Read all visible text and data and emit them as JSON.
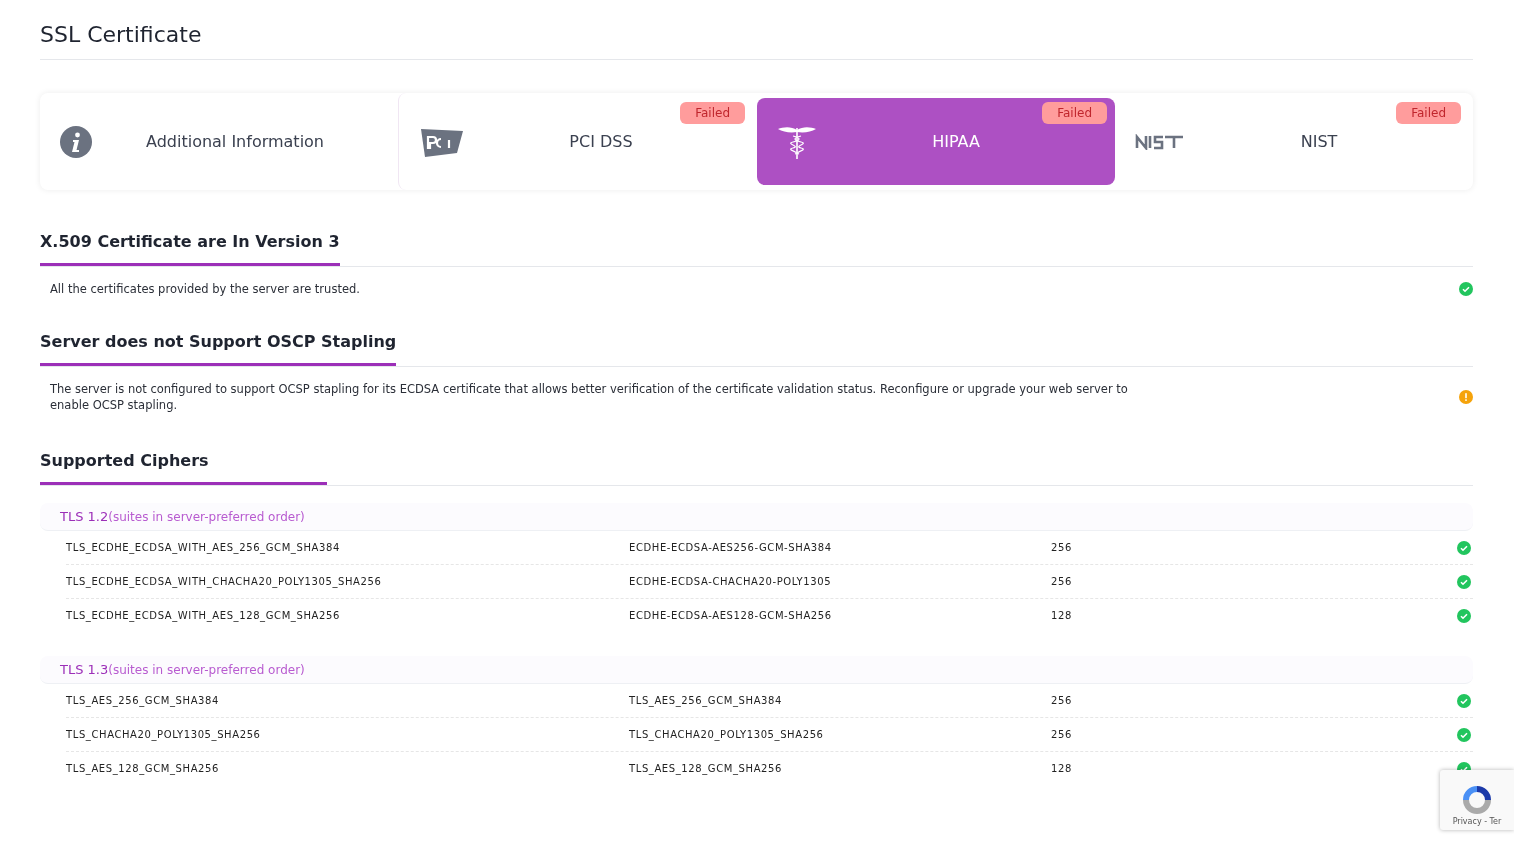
{
  "title": "SSL Certificate",
  "tabs": [
    {
      "kind": "info",
      "label": "Additional Information",
      "selected": false
    },
    {
      "kind": "pci",
      "label": "PCI DSS",
      "selected": false,
      "badge": "Failed"
    },
    {
      "kind": "hipaa",
      "label": "HIPAA",
      "selected": true,
      "badge": "Failed"
    },
    {
      "kind": "nist",
      "label": "NIST",
      "selected": false,
      "badge": "Failed"
    }
  ],
  "sections": [
    {
      "heading": "X.509 Certificate are In Version 3",
      "text": "All the certificates provided by the server are trusted.",
      "warning": false
    },
    {
      "heading": "Server does not Support OSCP Stapling",
      "text": "The server is not configured to support OCSP stapling for its ECDSA certificate that allows better verification of the certificate validation status. Reconfigure or upgrade your web server to enable OCSP stapling.",
      "warning": true
    }
  ],
  "ciphers": {
    "heading": "Supported Ciphers",
    "groups": [
      {
        "version": "TLS 1.2",
        "note": "(suites in server-preferred order)",
        "rows": [
          {
            "name": "TLS_ECDHE_ECDSA_WITH_AES_256_GCM_SHA384",
            "alias": "ECDHE-ECDSA-AES256-GCM-SHA384",
            "bits": "256",
            "warning": false
          },
          {
            "name": "TLS_ECDHE_ECDSA_WITH_CHACHA20_POLY1305_SHA256",
            "alias": "ECDHE-ECDSA-CHACHA20-POLY1305",
            "bits": "256",
            "warning": false
          },
          {
            "name": "TLS_ECDHE_ECDSA_WITH_AES_128_GCM_SHA256",
            "alias": "ECDHE-ECDSA-AES128-GCM-SHA256",
            "bits": "128",
            "warning": false
          }
        ]
      },
      {
        "version": "TLS 1.3",
        "note": "(suites in server-preferred order)",
        "rows": [
          {
            "name": "TLS_AES_256_GCM_SHA384",
            "alias": "TLS_AES_256_GCM_SHA384",
            "bits": "256",
            "warning": false
          },
          {
            "name": "TLS_CHACHA20_POLY1305_SHA256",
            "alias": "TLS_CHACHA20_POLY1305_SHA256",
            "bits": "256",
            "warning": false
          },
          {
            "name": "TLS_AES_128_GCM_SHA256",
            "alias": "TLS_AES_128_GCM_SHA256",
            "bits": "128",
            "warning": false
          }
        ]
      }
    ]
  },
  "recaptcha": {
    "text": "Privacy - Ter"
  }
}
